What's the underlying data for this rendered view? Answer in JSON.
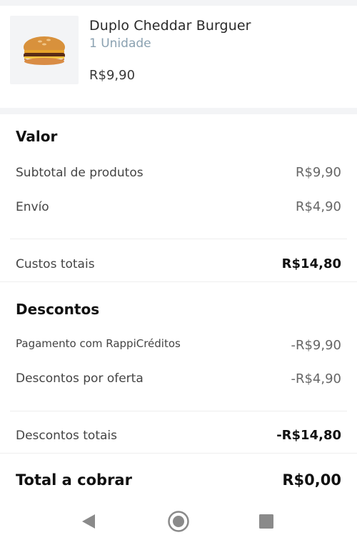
{
  "product": {
    "name": "Duplo Cheddar Burguer",
    "quantity": "1 Unidade",
    "price": "R$9,90",
    "image_icon": "burger-image"
  },
  "valor": {
    "title": "Valor",
    "subtotal_label": "Subtotal de produtos",
    "subtotal_value": "R$9,90",
    "envio_label": "Envío",
    "envio_value": "R$4,90",
    "custos_totais_label": "Custos totais",
    "custos_totais_value": "R$14,80"
  },
  "descontos": {
    "title": "Descontos",
    "rappi_label": "Pagamento com RappiCréditos",
    "rappi_value": "-R$9,90",
    "oferta_label": "Descontos por oferta",
    "oferta_value": "-R$4,90",
    "totais_label": "Descontos totais",
    "totais_value": "-R$14,80"
  },
  "total": {
    "label": "Total a cobrar",
    "value": "R$0,00"
  },
  "navbar": {
    "back_icon": "back-triangle-icon",
    "home_icon": "home-circle-icon",
    "recents_icon": "recents-square-icon",
    "icon_color": "#8a8a8a"
  }
}
